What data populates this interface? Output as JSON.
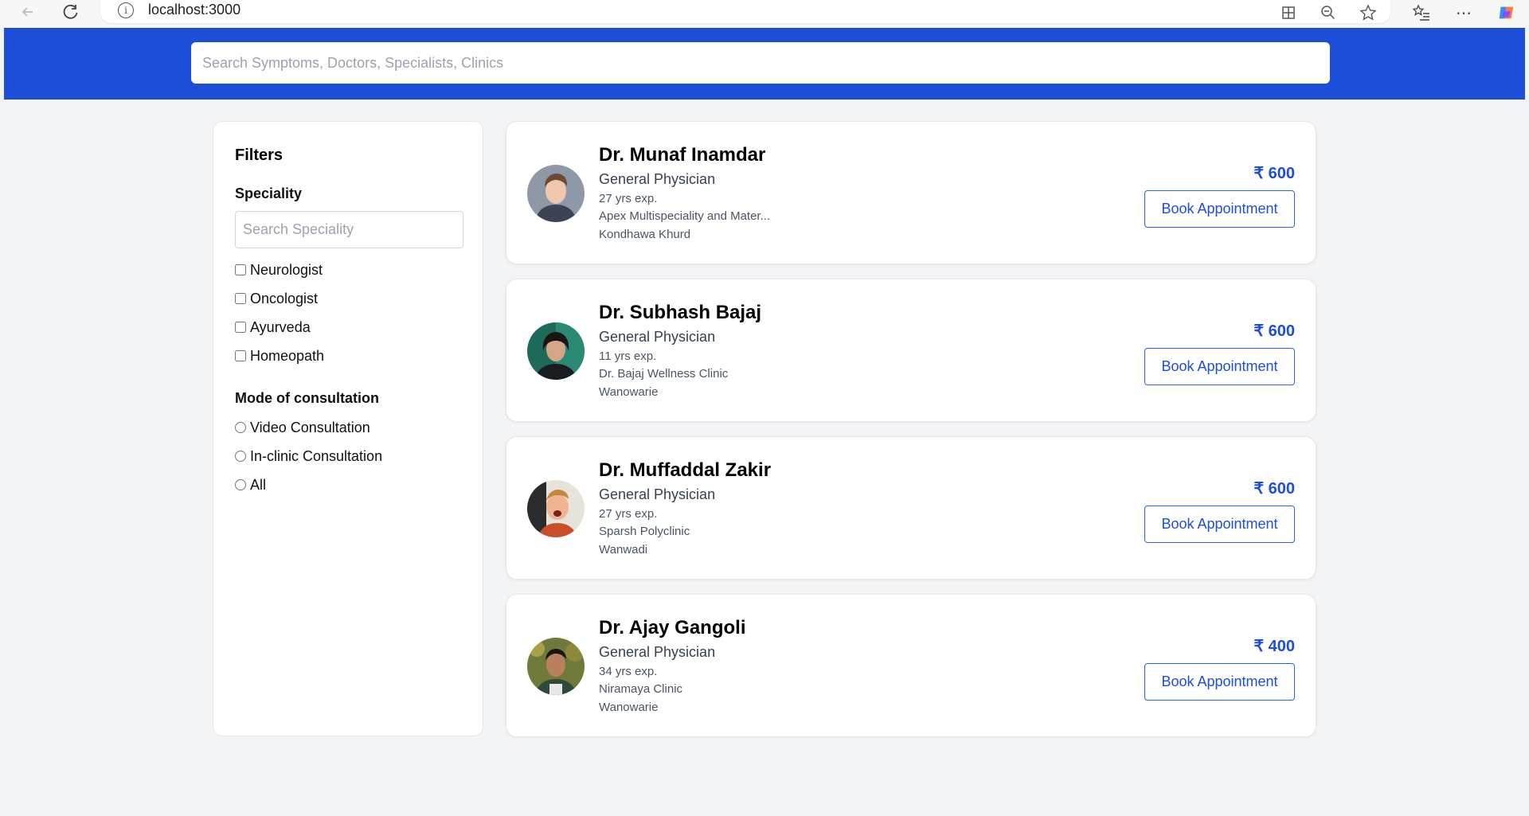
{
  "browser": {
    "url": "localhost:3000"
  },
  "search": {
    "placeholder": "Search Symptoms, Doctors, Specialists, Clinics"
  },
  "filters": {
    "title": "Filters",
    "speciality": {
      "title": "Speciality",
      "placeholder": "Search Speciality",
      "options": [
        "Neurologist",
        "Oncologist",
        "Ayurveda",
        "Homeopath"
      ]
    },
    "mode": {
      "title": "Mode of consultation",
      "options": [
        "Video Consultation",
        "In-clinic Consultation",
        "All"
      ]
    }
  },
  "doctors": [
    {
      "name": "Dr. Munaf Inamdar",
      "speciality": "General Physician",
      "experience": "27 yrs exp.",
      "clinic": "Apex Multispeciality and Mater...",
      "location": "Kondhawa Khurd",
      "fee": "₹ 600",
      "button": "Book Appointment"
    },
    {
      "name": "Dr. Subhash Bajaj",
      "speciality": "General Physician",
      "experience": "11 yrs exp.",
      "clinic": "Dr. Bajaj Wellness Clinic",
      "location": "Wanowarie",
      "fee": "₹ 600",
      "button": "Book Appointment"
    },
    {
      "name": "Dr. Muffaddal Zakir",
      "speciality": "General Physician",
      "experience": "27 yrs exp.",
      "clinic": "Sparsh Polyclinic",
      "location": "Wanwadi",
      "fee": "₹ 600",
      "button": "Book Appointment"
    },
    {
      "name": "Dr. Ajay Gangoli",
      "speciality": "General Physician",
      "experience": "34 yrs exp.",
      "clinic": "Niramaya Clinic",
      "location": "Wanowarie",
      "fee": "₹ 400",
      "button": "Book Appointment"
    }
  ],
  "colors": {
    "header": "#1d4ed8",
    "accent": "#1d4ed8",
    "background": "#f3f4f6"
  }
}
